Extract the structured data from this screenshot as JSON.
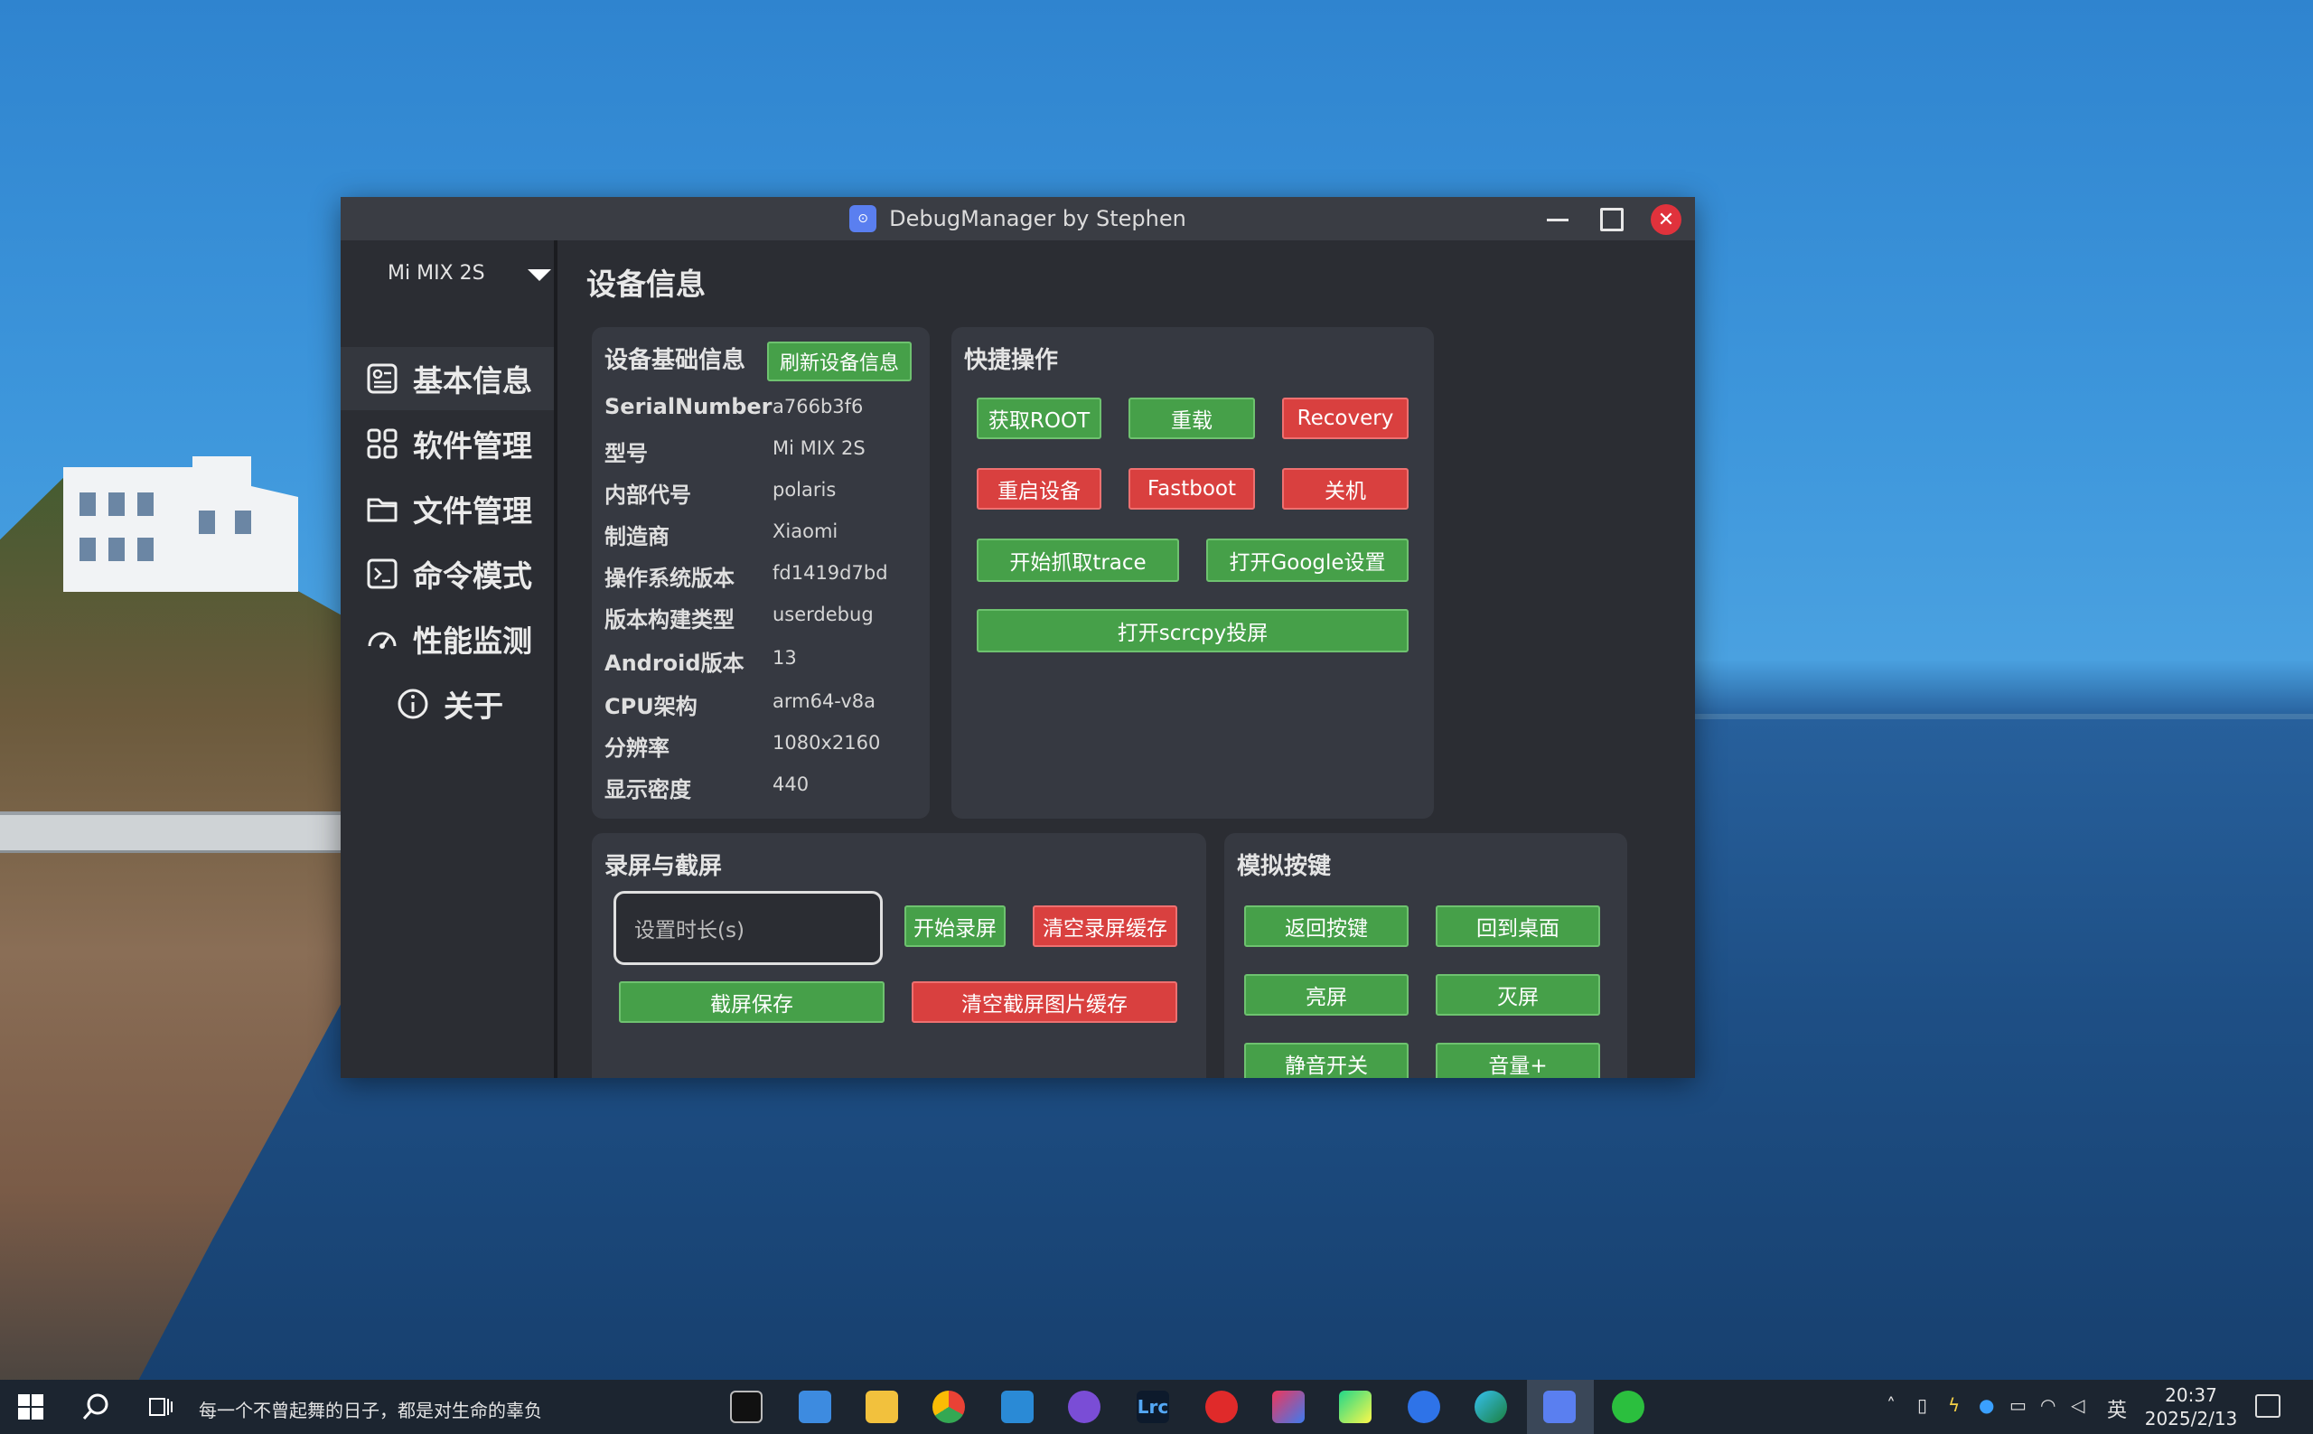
{
  "window": {
    "title": "DebugManager by Stephen",
    "close_glyph": "✕",
    "app_icon_glyph": "⊙"
  },
  "sidebar": {
    "device": "Mi MIX 2S",
    "items": [
      {
        "label": "基本信息",
        "icon": "info-card-icon"
      },
      {
        "label": "软件管理",
        "icon": "apps-grid-icon"
      },
      {
        "label": "文件管理",
        "icon": "folder-icon"
      },
      {
        "label": "命令模式",
        "icon": "terminal-icon"
      },
      {
        "label": "性能监测",
        "icon": "gauge-icon"
      },
      {
        "label": "关于",
        "icon": "about-icon"
      }
    ]
  },
  "main": {
    "title": "设备信息",
    "device_info": {
      "title": "设备基础信息",
      "refresh_label": "刷新设备信息",
      "rows": [
        {
          "key": "SerialNumber",
          "value": "a766b3f6"
        },
        {
          "key": "型号",
          "value": "Mi MIX 2S"
        },
        {
          "key": "内部代号",
          "value": "polaris"
        },
        {
          "key": "制造商",
          "value": "Xiaomi"
        },
        {
          "key": "操作系统版本",
          "value": "fd1419d7bd"
        },
        {
          "key": "版本构建类型",
          "value": "userdebug"
        },
        {
          "key": "Android版本",
          "value": "13"
        },
        {
          "key": "CPU架构",
          "value": "arm64-v8a"
        },
        {
          "key": "分辨率",
          "value": "1080x2160"
        },
        {
          "key": "显示密度",
          "value": "440"
        }
      ]
    },
    "quick_ops": {
      "title": "快捷操作",
      "get_root": "获取ROOT",
      "reload": "重载",
      "recovery": "Recovery",
      "reboot": "重启设备",
      "fastboot": "Fastboot",
      "shutdown": "关机",
      "trace": "开始抓取trace",
      "google_settings": "打开Google设置",
      "scrcpy": "打开scrcpy投屏"
    },
    "record": {
      "title": "录屏与截屏",
      "duration_placeholder": "设置时长(s)",
      "start_record": "开始录屏",
      "clear_record": "清空录屏缓存",
      "screenshot": "截屏保存",
      "clear_screenshot": "清空截屏图片缓存"
    },
    "keys": {
      "title": "模拟按键",
      "back": "返回按键",
      "home": "回到桌面",
      "screen_on": "亮屏",
      "screen_off": "灭屏",
      "mute": "静音开关",
      "volume": "音量+"
    }
  },
  "taskbar": {
    "search_text": "每一个不曾起舞的日子，都是对生命的辜负",
    "ime": "英",
    "time": "20:37",
    "date": "2025/2/13",
    "apps": [
      "terminal-app-icon",
      "control-panel-app-icon",
      "file-explorer-app-icon",
      "chrome-app-icon",
      "vscode-app-icon",
      "github-app-icon",
      "lightroom-app-icon",
      "netease-music-app-icon",
      "intellij-app-icon",
      "pycharm-app-icon",
      "xcode-app-icon",
      "edge-app-icon",
      "debugmanager-app-icon",
      "wechat-app-icon"
    ],
    "lightroom_label": "Lrc"
  },
  "colors": {
    "green": "#46a049",
    "red": "#d9403f",
    "window_bg": "#2b2d33",
    "card_bg": "#363941",
    "close": "#e0323c"
  }
}
